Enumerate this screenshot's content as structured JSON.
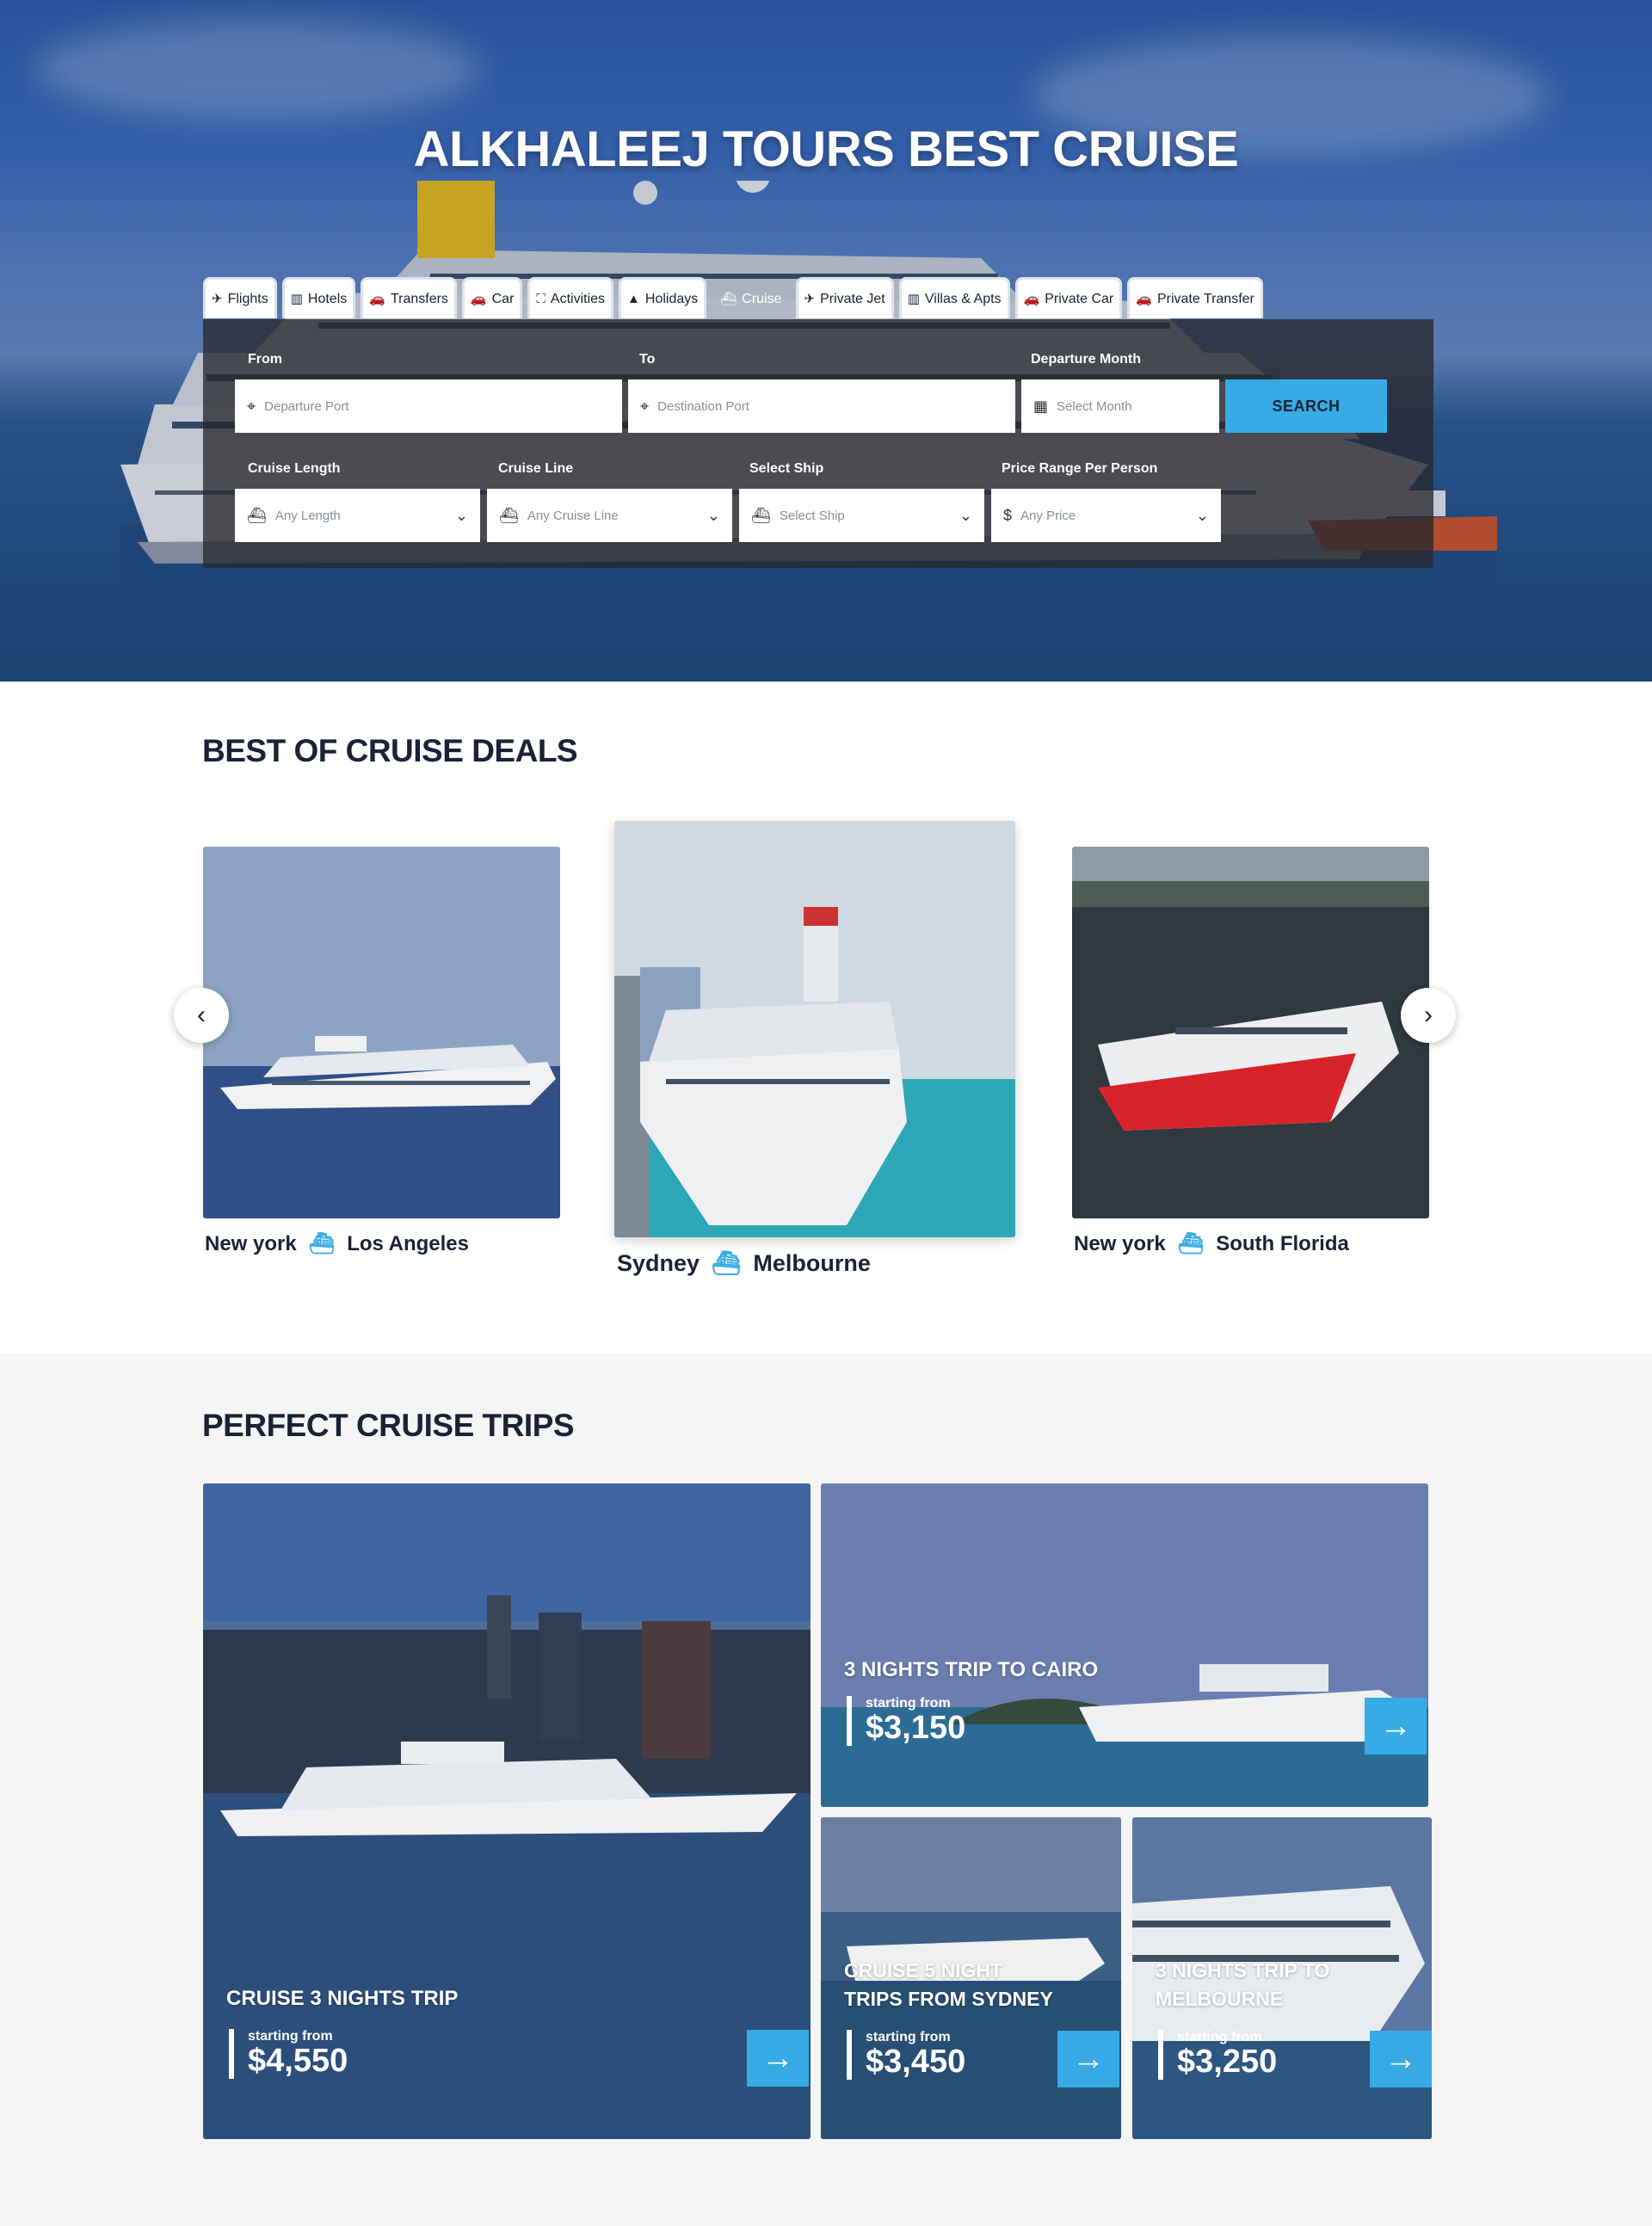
{
  "hero": {
    "title": "ALKHALEEJ TOURS BEST CRUISE"
  },
  "tabs": [
    {
      "label": "Flights",
      "icon": "plane-icon",
      "glyph": "✈"
    },
    {
      "label": "Hotels",
      "icon": "building-icon",
      "glyph": "▥"
    },
    {
      "label": "Transfers",
      "icon": "car-icon",
      "glyph": "🚗"
    },
    {
      "label": "Car",
      "icon": "car-icon",
      "glyph": "🚗"
    },
    {
      "label": "Activities",
      "icon": "binoculars-icon",
      "glyph": "⛶"
    },
    {
      "label": "Holidays",
      "icon": "tree-icon",
      "glyph": "▲"
    },
    {
      "label": "Cruise",
      "icon": "ship-icon",
      "glyph": "⛴",
      "active": true
    },
    {
      "label": "Private Jet",
      "icon": "plane-icon",
      "glyph": "✈"
    },
    {
      "label": "Villas & Apts",
      "icon": "building-icon",
      "glyph": "▥"
    },
    {
      "label": "Private Car",
      "icon": "car-icon",
      "glyph": "🚗"
    },
    {
      "label": "Private Transfer",
      "icon": "car-icon",
      "glyph": "🚗"
    }
  ],
  "search": {
    "from_label": "From",
    "from_placeholder": "Departure Port",
    "to_label": "To",
    "to_placeholder": "Destination Port",
    "month_label": "Departure Month",
    "month_placeholder": "Select Month",
    "button": "SEARCH",
    "length_label": "Cruise Length",
    "length_value": "Any Length",
    "line_label": "Cruise Line",
    "line_value": "Any Cruise Line",
    "ship_label": "Select Ship",
    "ship_value": "Select Ship",
    "price_label": "Price Range Per Person",
    "price_value": "Any Price"
  },
  "deals": {
    "title": "BEST OF CRUISE DEALS",
    "cards": [
      {
        "from": "New york",
        "to": "Los Angeles"
      },
      {
        "from": "Sydney",
        "to": "Melbourne"
      },
      {
        "from": "New york",
        "to": "South Florida"
      }
    ]
  },
  "trips": {
    "title": "PERFECT CRUISE TRIPS",
    "items": [
      {
        "title": "CRUISE 3 NIGHTS TRIP",
        "from_label": "starting from",
        "price": "$4,550"
      },
      {
        "title": "3 NIGHTS TRIP TO CAIRO",
        "from_label": "starting from",
        "price": "$3,150"
      },
      {
        "title_line1": "CRUISE 5 NIGHT",
        "title_line2": "TRIPS FROM SYDNEY",
        "from_label": "starting from",
        "price": "$3,450"
      },
      {
        "title_line1": "3 NIGHTS TRIP TO",
        "title_line2": "MELBOURNE",
        "from_label": "starting from",
        "price": "$3,250"
      }
    ]
  },
  "colors": {
    "accent": "#36abe6",
    "navy": "#1a2238",
    "panel": "#28282d"
  }
}
